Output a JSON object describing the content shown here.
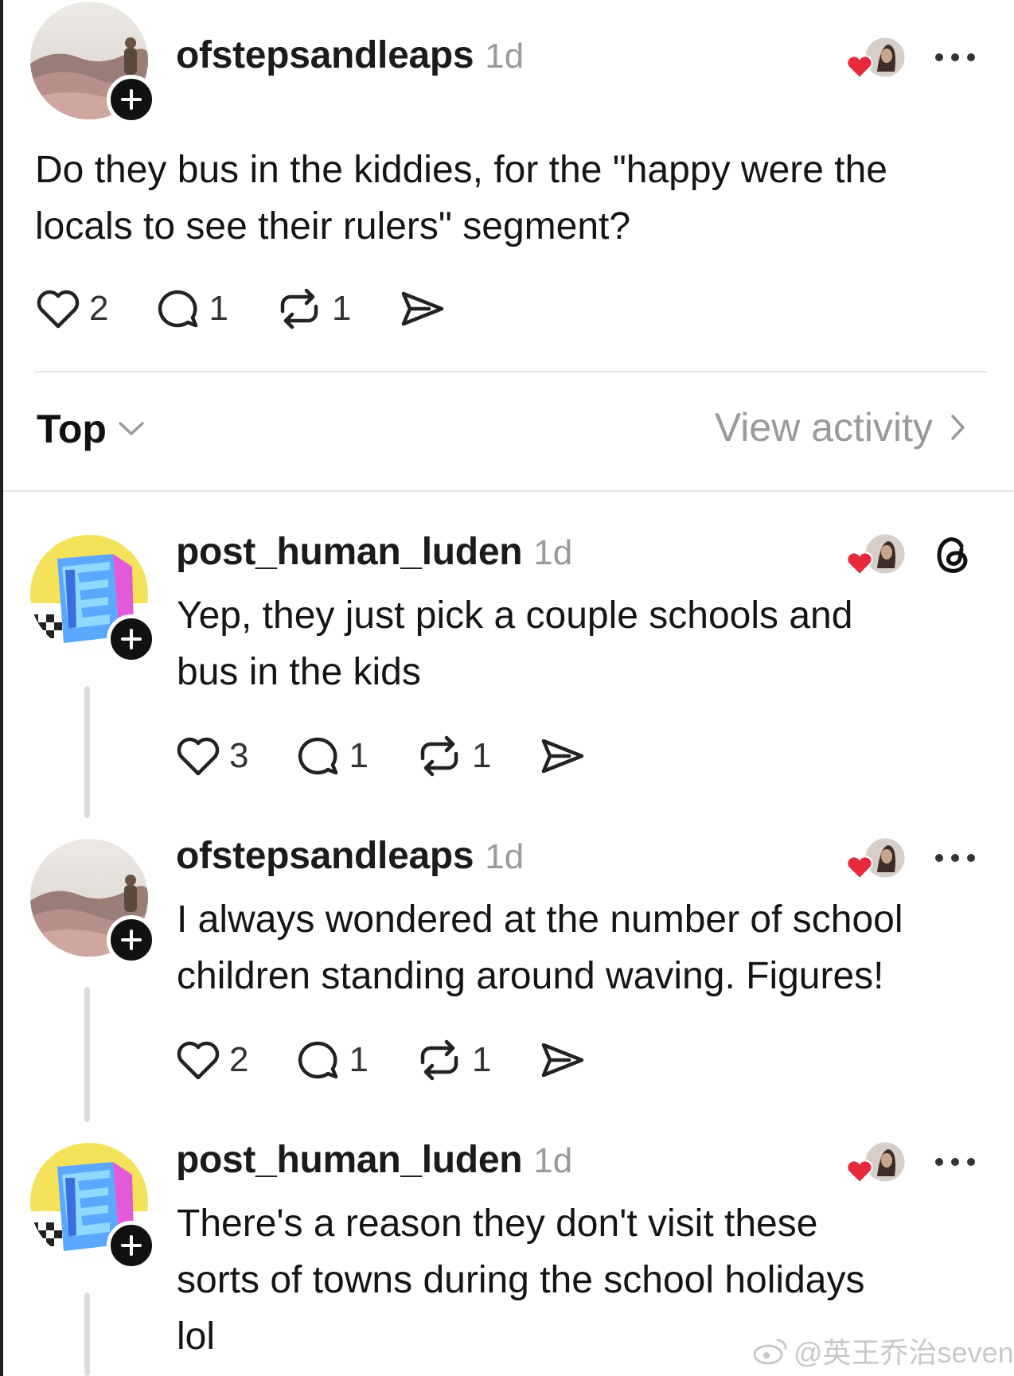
{
  "post": {
    "username": "ofstepsandleaps",
    "time": "1d",
    "text_line_1": "Do they bus in the kiddies, for the \"happy were the",
    "text_line_2": "locals to see their rulers\" segment?",
    "likes": "2",
    "replies": "1",
    "reposts": "1"
  },
  "sort_bar": {
    "sort_label": "Top",
    "view_activity_label": "View activity"
  },
  "replies": [
    {
      "username": "post_human_luden",
      "time": "1d",
      "text_line_1": "Yep, they just pick a couple schools and",
      "text_line_2": "bus in the kids",
      "likes": "3",
      "replies": "1",
      "reposts": "1"
    },
    {
      "username": "ofstepsandleaps",
      "time": "1d",
      "text_line_1": "I always wondered at the number of school",
      "text_line_2": "children standing around waving. Figures!",
      "likes": "2",
      "replies": "1",
      "reposts": "1"
    },
    {
      "username": "post_human_luden",
      "time": "1d",
      "text_line_1": "There's a reason they don't visit these",
      "text_line_2": "sorts of towns during the school holidays",
      "text_line_3": "lol"
    }
  ],
  "watermark": "@英王乔治seven",
  "colors": {
    "heart_red": "#e8293b",
    "muted_gray": "#9a9a9a",
    "divider": "#e4e4e4",
    "thread_line": "#dcdcdc"
  },
  "icons": [
    "plus-icon",
    "heart-icon",
    "comment-icon",
    "repost-icon",
    "share-icon",
    "more-icon",
    "threads-logo-icon",
    "chevron-down-icon",
    "chevron-right-icon"
  ]
}
